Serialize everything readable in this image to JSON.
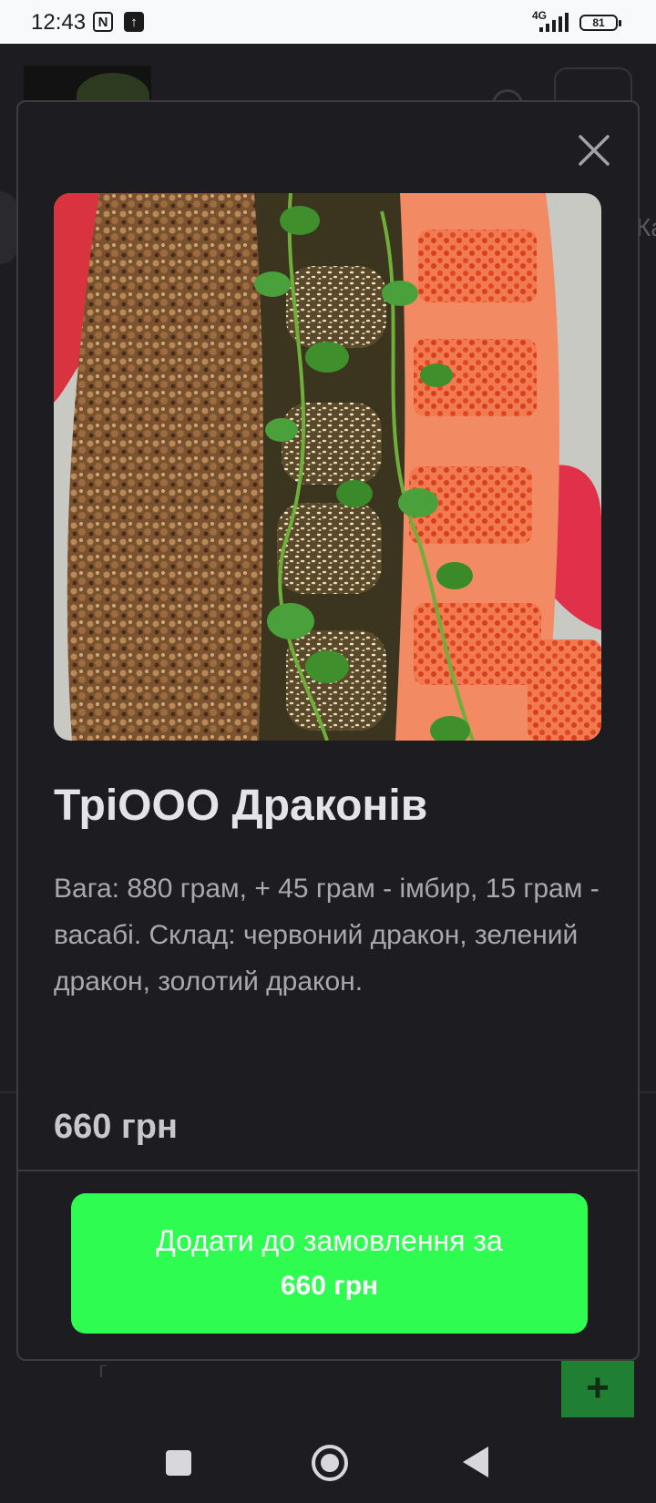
{
  "status_bar": {
    "time": "12:43",
    "nfc_icon": "N",
    "upload_icon": "↑",
    "network": "4G",
    "battery": "81"
  },
  "background_page": {
    "chip_text": "Ка",
    "add_icon": "+",
    "partial_text": "г"
  },
  "modal": {
    "close_icon": "close-icon",
    "product": {
      "title": "ТріООО Драконів",
      "description": "Вага: 880 грам, + 45 грам - імбир, 15 грам - васабі. Склад: червоний дракон, зелений дракон, золотий дракон.",
      "price": "660 грн"
    },
    "order_button": {
      "label": "Додати до замовлення за",
      "price": "660 грн"
    }
  },
  "colors": {
    "background": "#1d1c21",
    "accent": "#2ffc51",
    "modal_border": "#3d3c42"
  }
}
